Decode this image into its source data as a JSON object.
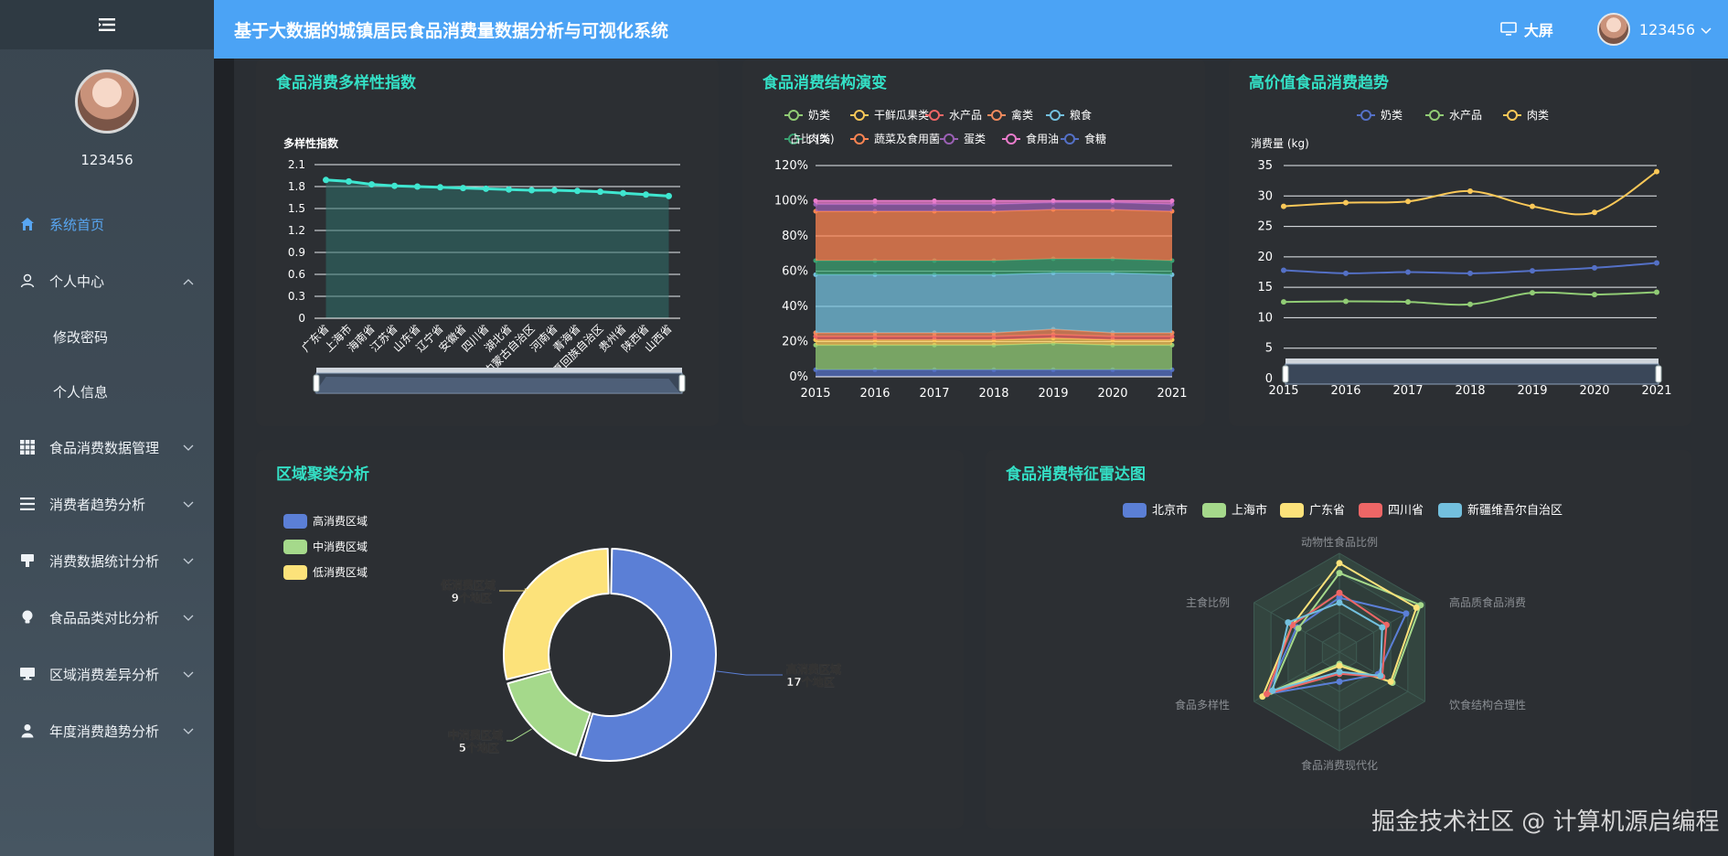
{
  "header": {
    "title": "基于大数据的城镇居民食品消费量数据分析与可视化系统",
    "screen_label": "大屏",
    "username": "123456"
  },
  "sidebar": {
    "username": "123456",
    "items": [
      {
        "label": "系统首页",
        "icon": "home-icon",
        "active": true
      },
      {
        "label": "个人中心",
        "icon": "user-icon",
        "expanded": true,
        "children": [
          "修改密码",
          "个人信息"
        ]
      },
      {
        "label": "食品消费数据管理",
        "icon": "grid-icon"
      },
      {
        "label": "消费者趋势分析",
        "icon": "list-icon"
      },
      {
        "label": "消费数据统计分析",
        "icon": "stamp-icon"
      },
      {
        "label": "食品品类对比分析",
        "icon": "bulb-icon"
      },
      {
        "label": "区域消费差异分析",
        "icon": "monitor-icon"
      },
      {
        "label": "年度消费趋势分析",
        "icon": "person-icon"
      }
    ]
  },
  "panels": {
    "diversity": {
      "title": "食品消费多样性指数"
    },
    "structure": {
      "title": "食品消费结构演变"
    },
    "highvalue": {
      "title": "高价值食品消费趋势"
    },
    "cluster": {
      "title": "区域聚类分析"
    },
    "radar": {
      "title": "食品消费特征雷达图"
    }
  },
  "watermark": "掘金技术社区 @ 计算机源启编程",
  "chart_data": [
    {
      "type": "area",
      "title": "食品消费多样性指数",
      "ylabel": "多样性指数",
      "ylim": [
        0,
        2.1
      ],
      "yticks": [
        "0",
        "0.3",
        "0.6",
        "0.9",
        "1.2",
        "1.5",
        "1.8",
        "2.1"
      ],
      "categories": [
        "广东省",
        "上海市",
        "海南省",
        "江苏省",
        "山东省",
        "辽宁省",
        "安徽省",
        "四川省",
        "湖北省",
        "内蒙古自治区",
        "河南省",
        "青海省",
        "宁夏回族自治区",
        "贵州省",
        "陕西省",
        "山西省"
      ],
      "values": [
        1.89,
        1.87,
        1.83,
        1.81,
        1.8,
        1.79,
        1.78,
        1.77,
        1.76,
        1.75,
        1.75,
        1.74,
        1.73,
        1.71,
        1.69,
        1.67
      ],
      "color": "#3fe6d0",
      "datazoom": true
    },
    {
      "type": "area",
      "title": "食品消费结构演变",
      "ylabel": "占比 (%)",
      "ylim": [
        0,
        120
      ],
      "stacked": true,
      "yticks": [
        "0%",
        "20%",
        "40%",
        "60%",
        "80%",
        "100%",
        "120%"
      ],
      "categories": [
        "2015",
        "2016",
        "2017",
        "2018",
        "2019",
        "2020",
        "2021"
      ],
      "legend": [
        "奶类",
        "干鲜瓜果类",
        "水产品",
        "禽类",
        "粮食",
        "肉类",
        "蔬菜及食用菌",
        "蛋类",
        "食用油",
        "食糖"
      ],
      "series": [
        {
          "name": "食糖",
          "color": "#5470c6",
          "values": [
            4,
            4,
            4,
            4,
            4,
            4,
            4
          ]
        },
        {
          "name": "奶类",
          "color": "#91cc75",
          "values": [
            14,
            14,
            14,
            14,
            15,
            14,
            14
          ]
        },
        {
          "name": "干鲜瓜果类",
          "color": "#fac858",
          "values": [
            3,
            3,
            3,
            3,
            3,
            3,
            3
          ]
        },
        {
          "name": "水产品",
          "color": "#ee6666",
          "values": [
            2,
            2,
            2,
            2,
            2,
            2,
            2
          ]
        },
        {
          "name": "禽类",
          "color": "#f08a5d",
          "values": [
            2,
            2,
            2,
            2,
            3,
            2,
            2
          ]
        },
        {
          "name": "粮食",
          "color": "#73c0de",
          "values": [
            33,
            33,
            33,
            33,
            32,
            34,
            33
          ]
        },
        {
          "name": "肉类",
          "color": "#3ba272",
          "values": [
            8,
            8,
            8,
            8,
            8,
            8,
            8
          ]
        },
        {
          "name": "蔬菜及食用菌",
          "color": "#fc8452",
          "values": [
            28,
            28,
            28,
            28,
            28,
            28,
            28
          ]
        },
        {
          "name": "蛋类",
          "color": "#9a60b4",
          "values": [
            4,
            4,
            4,
            4,
            4,
            4,
            4
          ]
        },
        {
          "name": "食用油",
          "color": "#ea7ccc",
          "values": [
            2,
            2,
            2,
            2,
            1,
            1,
            2
          ]
        }
      ]
    },
    {
      "type": "line",
      "title": "高价值食品消费趋势",
      "ylabel": "消费量 (kg)",
      "ylim": [
        0,
        35
      ],
      "categories": [
        "2015",
        "2016",
        "2017",
        "2018",
        "2019",
        "2020",
        "2021"
      ],
      "series": [
        {
          "name": "奶类",
          "color": "#5470c6",
          "values": [
            17.8,
            17.3,
            17.5,
            17.3,
            17.7,
            18.2,
            19.0
          ]
        },
        {
          "name": "水产品",
          "color": "#91cc75",
          "values": [
            12.6,
            12.7,
            12.6,
            12.2,
            14.1,
            13.8,
            14.2
          ]
        },
        {
          "name": "肉类",
          "color": "#fac858",
          "values": [
            28.3,
            28.9,
            29.1,
            30.8,
            28.3,
            27.3,
            34.0
          ]
        }
      ],
      "datazoom": true
    },
    {
      "type": "pie",
      "title": "区域聚类分析",
      "legend": [
        "高消费区域",
        "中消费区域",
        "低消费区域"
      ],
      "slices": [
        {
          "name": "高消费区域",
          "count": 17,
          "label": "17个地区",
          "color": "#5b7fd6"
        },
        {
          "name": "中消费区域",
          "count": 5,
          "label": "5个地区",
          "color": "#a5d98b"
        },
        {
          "name": "低消费区域",
          "count": 9,
          "label": "9个地区",
          "color": "#fce27a"
        }
      ]
    },
    {
      "type": "radar",
      "title": "食品消费特征雷达图",
      "indicators": [
        "动物性食品比例",
        "高品质食品消费",
        "饮食结构合理性",
        "食品消费现代化",
        "食品多样性",
        "主食比例"
      ],
      "series": [
        {
          "name": "北京市",
          "color": "#5b7fd6",
          "values": [
            0.55,
            0.78,
            0.45,
            0.3,
            0.85,
            0.5
          ]
        },
        {
          "name": "上海市",
          "color": "#a5d98b",
          "values": [
            0.8,
            0.95,
            0.62,
            0.12,
            0.8,
            0.48
          ]
        },
        {
          "name": "广东省",
          "color": "#fce27a",
          "values": [
            0.9,
            0.9,
            0.6,
            0.14,
            0.9,
            0.55
          ]
        },
        {
          "name": "四川省",
          "color": "#ee6666",
          "values": [
            0.6,
            0.55,
            0.5,
            0.22,
            0.85,
            0.55
          ]
        },
        {
          "name": "新疆维吾尔自治区",
          "color": "#73c0de",
          "values": [
            0.5,
            0.5,
            0.48,
            0.2,
            0.78,
            0.6
          ]
        }
      ]
    }
  ]
}
